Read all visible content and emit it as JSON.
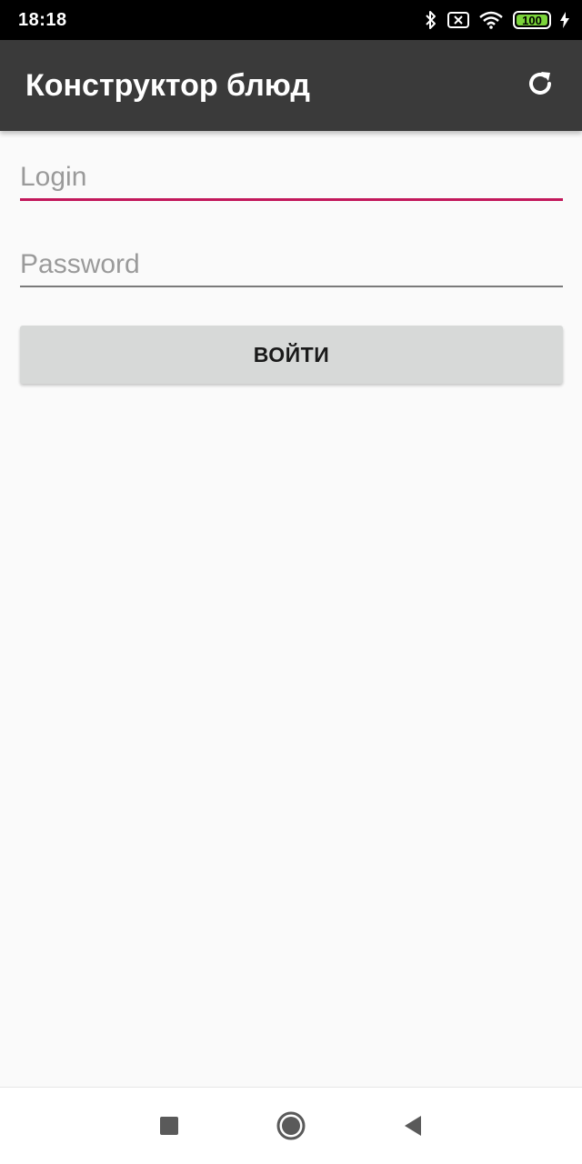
{
  "status_bar": {
    "time": "18:18",
    "battery_level": "100",
    "icons": [
      "bluetooth-icon",
      "no-sim-icon",
      "wifi-icon",
      "battery-icon",
      "charging-icon"
    ],
    "battery_color": "#7bd33a"
  },
  "app_bar": {
    "title": "Конструктор блюд",
    "action_icon": "refresh-icon",
    "background": "#3a3a3a"
  },
  "form": {
    "login": {
      "placeholder": "Login",
      "value": ""
    },
    "password": {
      "placeholder": "Password",
      "value": ""
    },
    "submit_label": "ВОЙТИ",
    "accent_color": "#c2185b"
  },
  "nav_bar": {
    "buttons": [
      "recents-square-icon",
      "home-circle-icon",
      "back-triangle-icon"
    ]
  }
}
